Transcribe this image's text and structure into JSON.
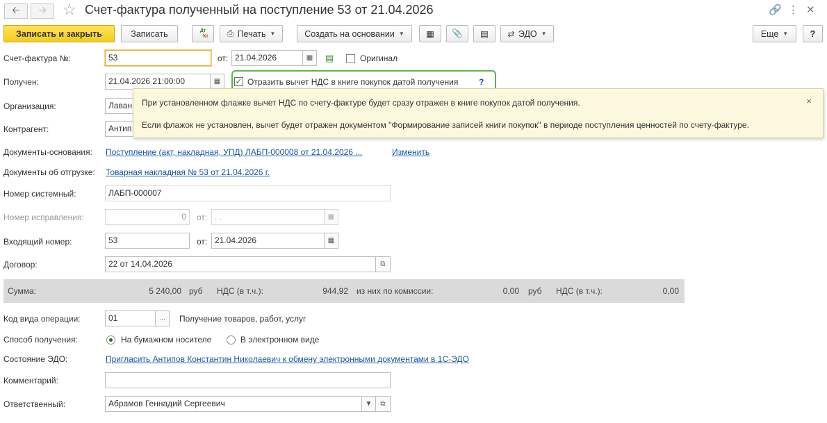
{
  "window": {
    "title": "Счет-фактура полученный на поступление 53 от 21.04.2026",
    "back_icon": "arrow-left-icon",
    "forward_icon": "arrow-right-icon"
  },
  "toolbar": {
    "save_close": "Записать и закрыть",
    "save": "Записать",
    "dt_kt_top": "Дт",
    "dt_kt_bottom": "Кт",
    "print": "Печать",
    "create_based": "Создать на основании",
    "edo": "ЭДО",
    "more": "Еще",
    "help": "?"
  },
  "form": {
    "invoice_label": "Счет-фактура №:",
    "invoice_number": "53",
    "from_label": "от:",
    "invoice_date": "21.04.2026",
    "original_label": "Оригинал",
    "received_label": "Получен:",
    "received_value": "21.04.2026 21:00:00",
    "reflect_vat_label": "Отразить вычет НДС в книге покупок датой получения",
    "reflect_vat_help": "?",
    "org_label": "Организация:",
    "org_value": "Лаван",
    "counterparty_label": "Контрагент:",
    "counterparty_value": "Антип",
    "basis_docs_label": "Документы-основания:",
    "basis_docs_link": "Поступление (акт, накладная, УПД) ЛАБП-000008 от 21.04.2026 ...",
    "change_link": "Изменить",
    "shipment_docs_label": "Документы об отгрузке:",
    "shipment_docs_link": "Товарная накладная № 53 от 21.04.2026 г.",
    "system_number_label": "Номер системный:",
    "system_number_value": "ЛАБП-000007",
    "correction_number_label": "Номер исправления:",
    "correction_number_value": "0",
    "correction_from_label": "от:",
    "correction_date_value": " .  .",
    "incoming_number_label": "Входящий номер:",
    "incoming_number_value": "53",
    "incoming_from_label": "от:",
    "incoming_date_value": "21.04.2026",
    "contract_label": "Договор:",
    "contract_value": "22 от 14.04.2026",
    "op_code_label": "Код вида операции:",
    "op_code_value": "01",
    "op_code_dots": "...",
    "op_code_desc": "Получение товаров, работ, услуг",
    "receive_method_label": "Способ получения:",
    "receive_paper": "На бумажном носителе",
    "receive_electronic": "В электронном виде",
    "edo_state_label": "Состояние ЭДО:",
    "edo_state_link": "Пригласить Антипов Константин Николаевич к обмену электронными документами в 1С-ЭДО",
    "comment_label": "Комментарий:",
    "comment_value": "",
    "responsible_label": "Ответственный:",
    "responsible_value": "Абрамов Геннадий Сергеевич"
  },
  "sum": {
    "label": "Сумма:",
    "amount": "5 240,00",
    "currency": "руб",
    "vat_label": "НДС (в т.ч.):",
    "vat_amount": "944,92",
    "commission_label": "из них по комиссии:",
    "commission_amount": "0,00",
    "commission_currency": "руб",
    "commission_vat_label": "НДС (в т.ч.):",
    "commission_vat_amount": "0,00"
  },
  "tooltip": {
    "line1": "При установленном флажке вычет НДС по счету-фактуре будет сразу отражен в книге покупок датой получения.",
    "line2": "Если флажок не установлен, вычет будет отражен документом \"Формирование записей книги покупок\" в периоде поступления ценностей по счету-фактуре.",
    "close": "×"
  },
  "colors": {
    "primary_button": "#f4cb1c",
    "link": "#1a56a6",
    "highlight": "#5bb34a",
    "tooltip_bg": "#fbf8dd",
    "sum_band": "#dadada"
  }
}
